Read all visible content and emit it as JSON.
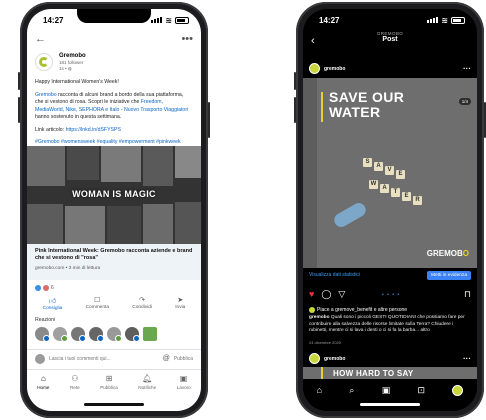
{
  "linkedin": {
    "status_time": "14:27",
    "company_name": "Gremobo",
    "followers": "181 follower",
    "posted": "1s • ",
    "p1": "Happy International Women's Week!",
    "p2_brand": "Gremobo",
    "p2_text": " racconta di alcuni brand a bordo della sua piattaforma, che si vestono di rosa. Scopri le iniziative che ",
    "p2_links": "Freedom, MediaWorld, Nike, SEPHORA e Italo - Nuovo Trasporto Viaggiatori",
    "p2_end": " hanno sostenuto in questa settimana.",
    "link_label": "Link articolo: ",
    "link_url": "https://lnkd.in/dSFYSPS",
    "hashtags": "#Gremobo #womensweek #equality #empowerment #pinkweek",
    "collage_title": "WOMAN IS MAGIC",
    "card_title": "Pink International Week: Gremobo racconta aziende e brand che si vestono di \"rosa\"",
    "card_domain": "gremobo.com • 3 min di lettura",
    "reactions_count": "6",
    "actions": [
      "Consiglia",
      "Commenta",
      "Condividi",
      "Invia"
    ],
    "reazioni_label": "Reazioni",
    "comment_placeholder": "Lascia i tuoi commenti qui...",
    "publish": "Pubblica",
    "nav": [
      "Home",
      "Rete",
      "Pubblica",
      "Notifiche",
      "Lavoro"
    ]
  },
  "instagram": {
    "status_time": "14:27",
    "header_user": "GREMOBO",
    "header_title": "Post",
    "username": "gremobo",
    "img_title_1": "SAVE OUR",
    "img_title_2": "WATER",
    "tiles_1": [
      "S",
      "A",
      "V",
      "E"
    ],
    "tiles_2": [
      "W",
      "A",
      "T",
      "E",
      "R"
    ],
    "brand": "GREMOB",
    "brand_o": "O",
    "badge": "1/4",
    "stats_link": "Visualizza dati statistici",
    "promote_btn": "Metti in evidenza",
    "likes_text": "Piace a gremove_benefit e altre persone",
    "caption_user": "gremobo",
    "caption": " Quali sono i piccoli GESTI QUOTIDIANI che possiamo fare per contribuire alla salvezza delle risorse limitate sulla Terra? Chiudere i rubinetti, mentre ci si lava i denti o ci si fa la barba... altro",
    "date": "24 dicembre 2020",
    "peek_text": "HOW HARD TO SAY"
  }
}
